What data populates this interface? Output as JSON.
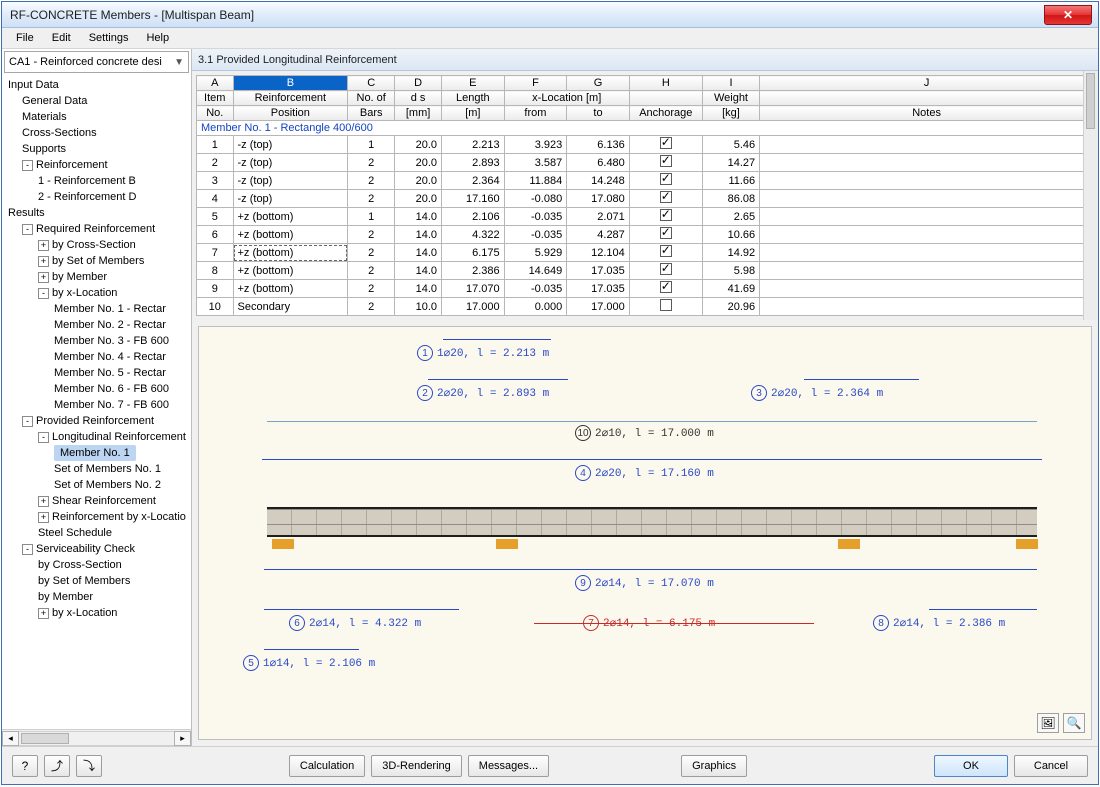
{
  "window": {
    "title": "RF-CONCRETE Members - [Multispan Beam]"
  },
  "menu": [
    "File",
    "Edit",
    "Settings",
    "Help"
  ],
  "combo": {
    "value": "CA1 - Reinforced concrete desi"
  },
  "tree": [
    {
      "lvl": 0,
      "label": "Input Data"
    },
    {
      "lvl": 1,
      "label": "General Data"
    },
    {
      "lvl": 1,
      "label": "Materials"
    },
    {
      "lvl": 1,
      "label": "Cross-Sections"
    },
    {
      "lvl": 1,
      "label": "Supports"
    },
    {
      "lvl": 1,
      "label": "Reinforcement",
      "exp": "-"
    },
    {
      "lvl": 2,
      "label": "1 - Reinforcement B"
    },
    {
      "lvl": 2,
      "label": "2 - Reinforcement D"
    },
    {
      "lvl": 0,
      "label": "Results"
    },
    {
      "lvl": 1,
      "label": "Required Reinforcement",
      "exp": "-"
    },
    {
      "lvl": 2,
      "label": "by Cross-Section",
      "exp": "+"
    },
    {
      "lvl": 2,
      "label": "by Set of Members",
      "exp": "+"
    },
    {
      "lvl": 2,
      "label": "by Member",
      "exp": "+"
    },
    {
      "lvl": 2,
      "label": "by x-Location",
      "exp": "-"
    },
    {
      "lvl": 3,
      "label": "Member No. 1 - Rectar"
    },
    {
      "lvl": 3,
      "label": "Member No. 2 - Rectar"
    },
    {
      "lvl": 3,
      "label": "Member No. 3 - FB 600"
    },
    {
      "lvl": 3,
      "label": "Member No. 4 - Rectar"
    },
    {
      "lvl": 3,
      "label": "Member No. 5 - Rectar"
    },
    {
      "lvl": 3,
      "label": "Member No. 6 - FB 600"
    },
    {
      "lvl": 3,
      "label": "Member No. 7 - FB 600"
    },
    {
      "lvl": 1,
      "label": "Provided Reinforcement",
      "exp": "-"
    },
    {
      "lvl": 2,
      "label": "Longitudinal Reinforcement",
      "exp": "-"
    },
    {
      "lvl": 3,
      "label": "Member No. 1",
      "selected": true
    },
    {
      "lvl": 3,
      "label": "Set of Members No. 1"
    },
    {
      "lvl": 3,
      "label": "Set of Members No. 2"
    },
    {
      "lvl": 2,
      "label": "Shear Reinforcement",
      "exp": "+"
    },
    {
      "lvl": 2,
      "label": "Reinforcement by x-Locatio",
      "exp": "+"
    },
    {
      "lvl": 2,
      "label": "Steel Schedule"
    },
    {
      "lvl": 1,
      "label": "Serviceability Check",
      "exp": "-"
    },
    {
      "lvl": 2,
      "label": "by Cross-Section"
    },
    {
      "lvl": 2,
      "label": "by Set of Members"
    },
    {
      "lvl": 2,
      "label": "by Member"
    },
    {
      "lvl": 2,
      "label": "by x-Location",
      "exp": "+"
    }
  ],
  "section_title": "3.1 Provided Longitudinal Reinforcement",
  "grid": {
    "cols_letters": [
      "A",
      "B",
      "C",
      "D",
      "E",
      "F",
      "G",
      "H",
      "I",
      "J"
    ],
    "header1": [
      "Item",
      "Reinforcement",
      "No. of",
      "d s",
      "Length",
      "x-Location [m]",
      "",
      "",
      "Weight",
      ""
    ],
    "header2": [
      "No.",
      "Position",
      "Bars",
      "[mm]",
      "[m]",
      "from",
      "to",
      "Anchorage",
      "[kg]",
      "Notes"
    ],
    "group": "Member No. 1  -  Rectangle 400/600",
    "rows": [
      {
        "n": "1",
        "pos": "-z (top)",
        "bars": "1",
        "ds": "20.0",
        "len": "2.213",
        "from": "3.923",
        "to": "6.136",
        "anch": true,
        "wt": "5.46"
      },
      {
        "n": "2",
        "pos": "-z (top)",
        "bars": "2",
        "ds": "20.0",
        "len": "2.893",
        "from": "3.587",
        "to": "6.480",
        "anch": true,
        "wt": "14.27"
      },
      {
        "n": "3",
        "pos": "-z (top)",
        "bars": "2",
        "ds": "20.0",
        "len": "2.364",
        "from": "11.884",
        "to": "14.248",
        "anch": true,
        "wt": "11.66"
      },
      {
        "n": "4",
        "pos": "-z (top)",
        "bars": "2",
        "ds": "20.0",
        "len": "17.160",
        "from": "-0.080",
        "to": "17.080",
        "anch": true,
        "wt": "86.08"
      },
      {
        "n": "5",
        "pos": "+z (bottom)",
        "bars": "1",
        "ds": "14.0",
        "len": "2.106",
        "from": "-0.035",
        "to": "2.071",
        "anch": true,
        "wt": "2.65"
      },
      {
        "n": "6",
        "pos": "+z (bottom)",
        "bars": "2",
        "ds": "14.0",
        "len": "4.322",
        "from": "-0.035",
        "to": "4.287",
        "anch": true,
        "wt": "10.66"
      },
      {
        "n": "7",
        "pos": "+z (bottom)",
        "bars": "2",
        "ds": "14.0",
        "len": "6.175",
        "from": "5.929",
        "to": "12.104",
        "anch": true,
        "wt": "14.92",
        "focus": true
      },
      {
        "n": "8",
        "pos": "+z (bottom)",
        "bars": "2",
        "ds": "14.0",
        "len": "2.386",
        "from": "14.649",
        "to": "17.035",
        "anch": true,
        "wt": "5.98"
      },
      {
        "n": "9",
        "pos": "+z (bottom)",
        "bars": "2",
        "ds": "14.0",
        "len": "17.070",
        "from": "-0.035",
        "to": "17.035",
        "anch": true,
        "wt": "41.69"
      },
      {
        "n": "10",
        "pos": "Secondary",
        "bars": "2",
        "ds": "10.0",
        "len": "17.000",
        "from": "0.000",
        "to": "17.000",
        "anch": false,
        "wt": "20.96"
      }
    ]
  },
  "graphic": {
    "labels": [
      {
        "id": "1",
        "txt": "1⌀20, l = 2.213 m",
        "color": "blue"
      },
      {
        "id": "2",
        "txt": "2⌀20, l = 2.893 m",
        "color": "blue"
      },
      {
        "id": "3",
        "txt": "2⌀20, l = 2.364 m",
        "color": "blue"
      },
      {
        "id": "10",
        "txt": "2⌀10, l = 17.000 m",
        "color": "black"
      },
      {
        "id": "4",
        "txt": "2⌀20, l = 17.160 m",
        "color": "blue"
      },
      {
        "id": "9",
        "txt": "2⌀14, l = 17.070 m",
        "color": "blue"
      },
      {
        "id": "6",
        "txt": "2⌀14, l = 4.322 m",
        "color": "blue"
      },
      {
        "id": "7",
        "txt": "2⌀14, l = 6.175 m",
        "color": "red"
      },
      {
        "id": "8",
        "txt": "2⌀14, l = 2.386 m",
        "color": "blue"
      },
      {
        "id": "5",
        "txt": "1⌀14, l = 2.106 m",
        "color": "blue"
      }
    ]
  },
  "footer": {
    "calculation": "Calculation",
    "rendering": "3D-Rendering",
    "messages": "Messages...",
    "graphics": "Graphics",
    "ok": "OK",
    "cancel": "Cancel"
  }
}
